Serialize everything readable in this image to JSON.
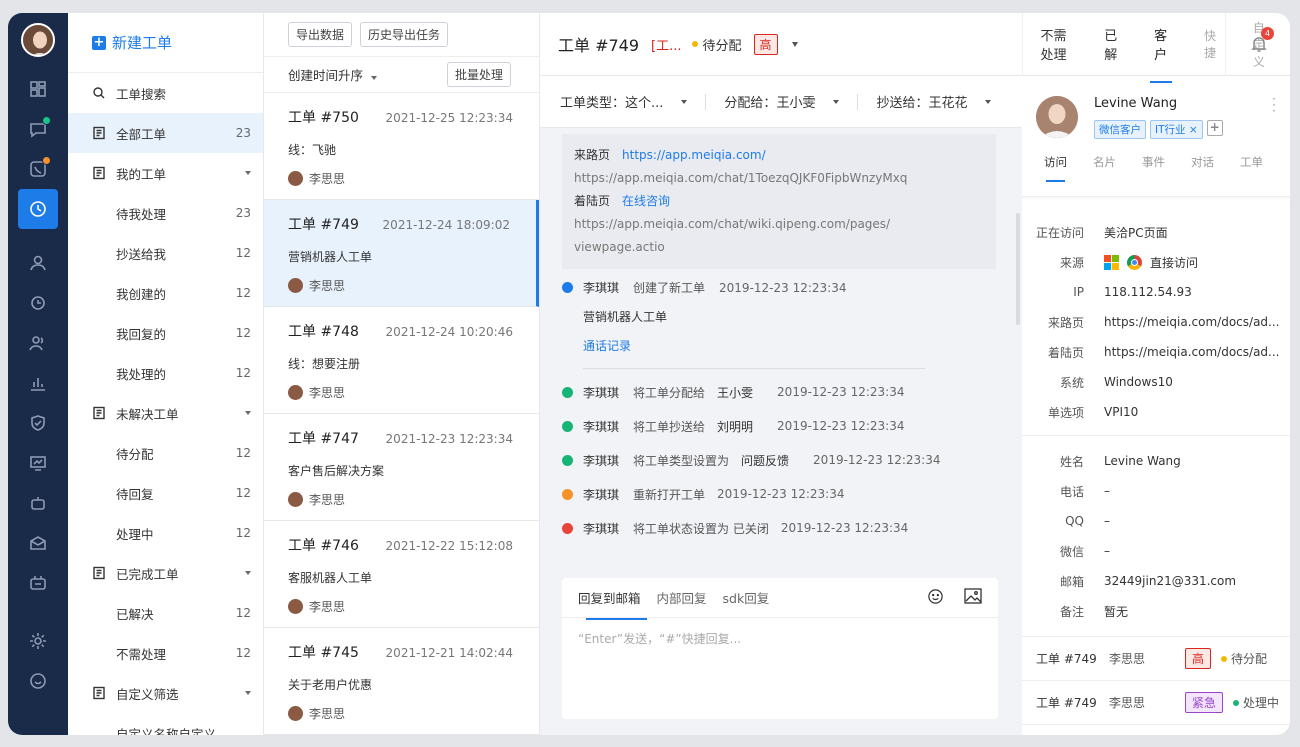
{
  "nav": {
    "new_ticket": "新建工单",
    "items": [
      {
        "label": "工单搜索",
        "count": "",
        "kind": "search"
      },
      {
        "label": "全部工单",
        "count": "23",
        "kind": "doc",
        "selected": true
      },
      {
        "label": "我的工单",
        "count": "",
        "kind": "doc",
        "caret": true
      },
      {
        "label": "待我处理",
        "count": "23",
        "sub": true
      },
      {
        "label": "抄送给我",
        "count": "12",
        "sub": true
      },
      {
        "label": "我创建的",
        "count": "12",
        "sub": true
      },
      {
        "label": "我回复的",
        "count": "12",
        "sub": true
      },
      {
        "label": "我处理的",
        "count": "12",
        "sub": true
      },
      {
        "label": "未解决工单",
        "count": "",
        "kind": "doc",
        "caret": true
      },
      {
        "label": "待分配",
        "count": "12",
        "sub": true
      },
      {
        "label": "待回复",
        "count": "12",
        "sub": true
      },
      {
        "label": "处理中",
        "count": "12",
        "sub": true
      },
      {
        "label": "已完成工单",
        "count": "",
        "kind": "doc",
        "caret": true
      },
      {
        "label": "已解决",
        "count": "12",
        "sub": true
      },
      {
        "label": "不需处理",
        "count": "12",
        "sub": true
      },
      {
        "label": "自定义筛选",
        "count": "",
        "kind": "doc",
        "caret": true
      },
      {
        "label": "自定义名称自定义",
        "count": "",
        "sub": true
      }
    ]
  },
  "list": {
    "export_btn": "导出数据",
    "history_btn": "历史导出任务",
    "sort_label": "创建时间升序",
    "batch_btn": "批量处理",
    "cards": [
      {
        "no": "工单 #750",
        "time": "2021-12-25 12:23:34",
        "desc": "线：飞驰",
        "user": "李思思"
      },
      {
        "no": "工单 #749",
        "time": "2021-12-24 18:09:02",
        "desc": "营销机器人工单",
        "user": "李思思",
        "selected": true
      },
      {
        "no": "工单 #748",
        "time": "2021-12-24 10:20:46",
        "desc": "线：想要注册",
        "user": "李思思"
      },
      {
        "no": "工单 #747",
        "time": "2021-12-23 12:23:34",
        "desc": "客户售后解决方案",
        "user": "李思思"
      },
      {
        "no": "工单 #746",
        "time": "2021-12-22 15:12:08",
        "desc": "客服机器人工单",
        "user": "李思思"
      },
      {
        "no": "工单 #745",
        "time": "2021-12-21 14:02:44",
        "desc": "关于老用户优惠",
        "user": "李思思"
      }
    ]
  },
  "detail": {
    "ticket_no": "工单 #749",
    "title_red": "[工...",
    "status": "待分配",
    "priority": "高",
    "filters": {
      "type_label": "工单类型：",
      "type_value": "这个...",
      "assign_label": "分配给：",
      "assign_value": "王小雯",
      "cc_label": "抄送给：",
      "cc_value": "王花花"
    },
    "info": {
      "referrer_label": "来路页",
      "referrer_link": "https://app.meiqia.com/",
      "referrer_full": "https://app.meiqia.com/chat/1ToezqQJKF0FipbWnzyMxq",
      "landing_label": "着陆页",
      "landing_link": "在线咨询",
      "landing_full_1": "https://app.meiqia.com/chat/wiki.qipeng.com/pages/",
      "landing_full_2": "viewpage.actio"
    },
    "create_event": {
      "name": "李琪琪",
      "action": "创建了新工单",
      "time": "2019-12-23 12:23:34",
      "content": "营销机器人工单",
      "link": "通话记录"
    },
    "events": [
      {
        "name": "李琪琪",
        "action": "将工单分配给",
        "target": "王小雯",
        "time": "2019-12-23 12:23:34",
        "color": "#18b477"
      },
      {
        "name": "李琪琪",
        "action": "将工单抄送给",
        "target": "刘明明",
        "time": "2019-12-23 12:23:34",
        "color": "#18b477"
      },
      {
        "name": "李琪琪",
        "action": "将工单类型设置为",
        "target": "问题反馈",
        "time": "2019-12-23 12:23:34",
        "color": "#18b477"
      },
      {
        "name": "李琪琪",
        "action": "重新打开工单",
        "target": "",
        "time": "2019-12-23 12:23:34",
        "color": "#f5922a"
      },
      {
        "name": "李琪琪",
        "action": "将工单状态设置为 已关闭",
        "target": "",
        "time": "2019-12-23 12:23:34",
        "color": "#e9443a"
      }
    ],
    "reply": {
      "tab1": "回复到邮箱",
      "tab2": "内部回复",
      "tab3": "sdk回复",
      "placeholder": "“Enter”发送，“#”快捷回复..."
    }
  },
  "right_tabs": [
    "不需处理",
    "已解",
    "客户",
    "快捷",
    "自定义"
  ],
  "notif_count": "4",
  "profile": {
    "name": "Levine Wang",
    "tags": [
      "微信客户",
      "IT行业"
    ],
    "subtabs": [
      "访问",
      "名片",
      "事件",
      "对话",
      "工单"
    ],
    "visit": [
      {
        "k": "正在访问",
        "v": "美洽PC页面"
      },
      {
        "k": "来源",
        "v": "直接访问"
      },
      {
        "k": "IP",
        "v": "118.112.54.93"
      },
      {
        "k": "来路页",
        "v": "https://meiqia.com/docs/ad..."
      },
      {
        "k": "着陆页",
        "v": "https://meiqia.com/docs/ad..."
      },
      {
        "k": "系统",
        "v": "Windows10"
      },
      {
        "k": "单选项",
        "v": "VPI10"
      }
    ],
    "card": [
      {
        "k": "姓名",
        "v": "Levine Wang"
      },
      {
        "k": "电话",
        "v": "–"
      },
      {
        "k": "QQ",
        "v": "–"
      },
      {
        "k": "微信",
        "v": "–"
      },
      {
        "k": "邮箱",
        "v": "32449jin21@331.com"
      },
      {
        "k": "备注",
        "v": "暂无"
      }
    ],
    "tickets": [
      {
        "no": "工单 #749",
        "user": "李思思",
        "pri": "高",
        "status": "待分配",
        "dot": "#f5b800",
        "cls": "p1"
      },
      {
        "no": "工单 #749",
        "user": "李思思",
        "pri": "紧急",
        "status": "处理中",
        "dot": "#18b477",
        "cls": "p2"
      }
    ]
  }
}
